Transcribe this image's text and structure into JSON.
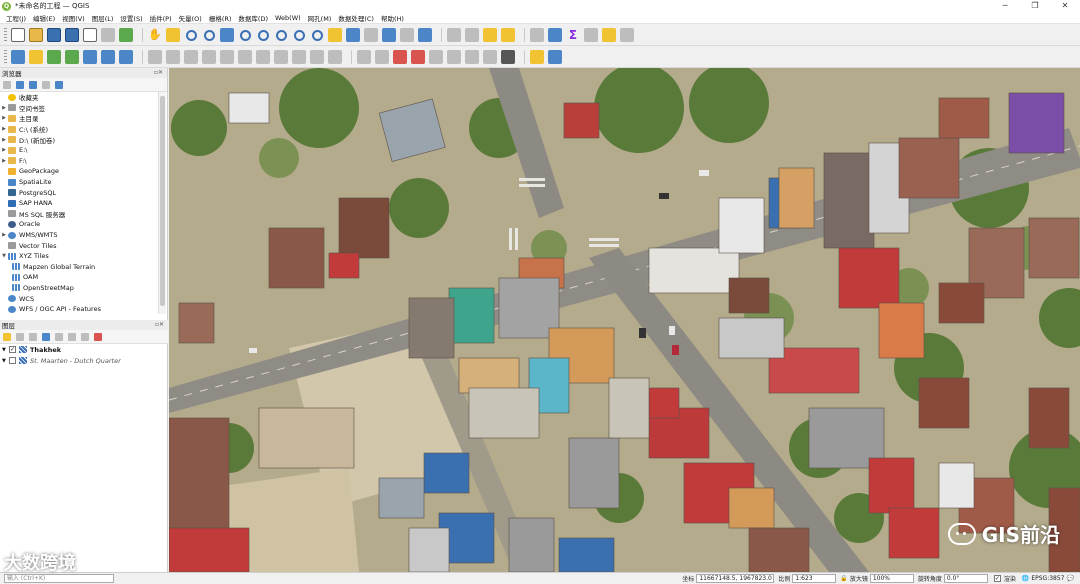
{
  "window": {
    "title": "*未命名的工程 — QGIS",
    "minimize_icon": "─",
    "maximize_icon": "❐",
    "close_icon": "✕"
  },
  "menu": [
    "工程(J)",
    "编辑(E)",
    "视图(V)",
    "图层(L)",
    "设置(S)",
    "插件(P)",
    "矢量(O)",
    "栅格(R)",
    "数据库(D)",
    "Web(W)",
    "网孔(M)",
    "数据处理(C)",
    "帮助(H)"
  ],
  "browser_panel": {
    "title": "浏览器",
    "items": [
      {
        "label": "收藏夹",
        "icon": "star-icon",
        "expandable": false
      },
      {
        "label": "空间书签",
        "icon": "bookmark-icon",
        "expandable": true
      },
      {
        "label": "主目录",
        "icon": "folder-icon",
        "expandable": true
      },
      {
        "label": "C:\\ (系统)",
        "icon": "drive-icon",
        "expandable": true
      },
      {
        "label": "D:\\ (新加卷)",
        "icon": "drive-icon",
        "expandable": true
      },
      {
        "label": "E:\\",
        "icon": "drive-icon",
        "expandable": true
      },
      {
        "label": "F:\\",
        "icon": "drive-icon",
        "expandable": true
      },
      {
        "label": "GeoPackage",
        "icon": "geopackage-icon",
        "expandable": false
      },
      {
        "label": "SpatiaLite",
        "icon": "spatialite-icon",
        "expandable": false
      },
      {
        "label": "PostgreSQL",
        "icon": "postgresql-icon",
        "expandable": false
      },
      {
        "label": "SAP HANA",
        "icon": "sap-hana-icon",
        "expandable": false
      },
      {
        "label": "MS SQL 服务器",
        "icon": "mssql-icon",
        "expandable": false
      },
      {
        "label": "Oracle",
        "icon": "oracle-icon",
        "expandable": false
      },
      {
        "label": "WMS/WMTS",
        "icon": "globe-icon",
        "expandable": true
      },
      {
        "label": "Vector Tiles",
        "icon": "vector-tiles-icon",
        "expandable": false
      },
      {
        "label": "XYZ Tiles",
        "icon": "grid-icon",
        "expandable": true
      },
      {
        "label": "Mapzen Global Terrain",
        "icon": "grid-icon",
        "expandable": false,
        "indent": true
      },
      {
        "label": "OAM",
        "icon": "grid-icon",
        "expandable": false,
        "indent": true
      },
      {
        "label": "OpenStreetMap",
        "icon": "grid-icon",
        "expandable": false,
        "indent": true
      },
      {
        "label": "WCS",
        "icon": "globe-icon",
        "expandable": false
      },
      {
        "label": "WFS / OGC API - Features",
        "icon": "globe-icon",
        "expandable": false
      }
    ]
  },
  "layers_panel": {
    "title": "图层",
    "layers": [
      {
        "name": "Thakhek",
        "checked": true,
        "bold": true,
        "italic": false
      },
      {
        "name": "St. Maarten - Dutch Quarter",
        "checked": false,
        "bold": false,
        "italic": true
      }
    ]
  },
  "watermark": {
    "right": "GIS前沿",
    "left": "大数跨境"
  },
  "statusbar": {
    "search_placeholder": "输入 (Ctrl+K)",
    "coord_label": "坐标",
    "coord_value": "11667148.5, 1967823.0",
    "scale_label": "比例",
    "scale_value": "1:623",
    "magnifier_label": "放大镜",
    "magnifier_value": "100%",
    "rotation_label": "旋转角度",
    "rotation_value": "0.0°",
    "render_label": "渲染",
    "crs_value": "EPSG:3857"
  }
}
